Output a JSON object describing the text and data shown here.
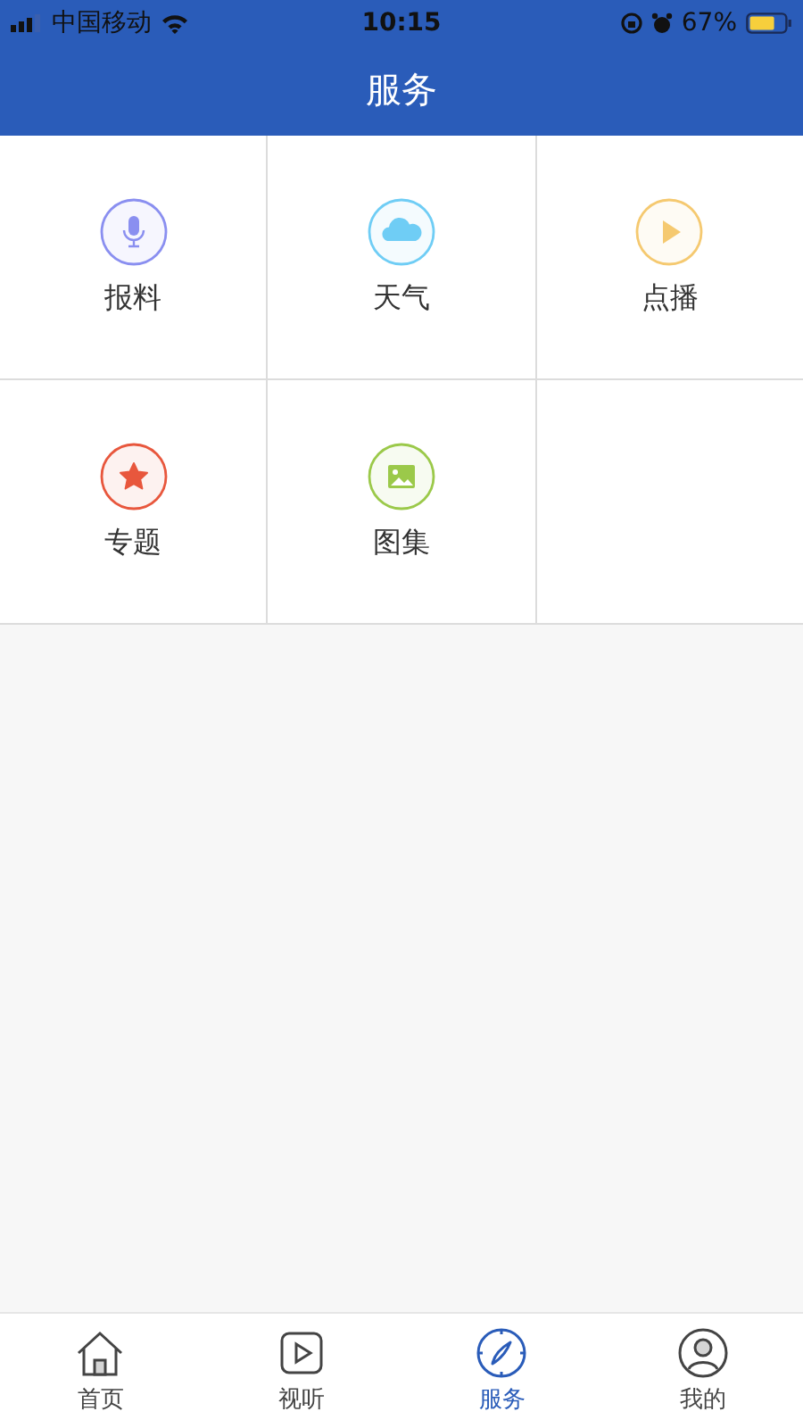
{
  "status_bar": {
    "carrier": "中国移动",
    "time": "10:15",
    "battery": "67%"
  },
  "header": {
    "title": "服务"
  },
  "services": [
    {
      "label": "报料",
      "kind": "mic",
      "color": "#8a8ff0"
    },
    {
      "label": "天气",
      "kind": "cloud",
      "color": "#6fcdf5"
    },
    {
      "label": "点播",
      "kind": "play",
      "color": "#f5c970"
    },
    {
      "label": "专题",
      "kind": "star",
      "color": "#e8573d"
    },
    {
      "label": "图集",
      "kind": "image",
      "color": "#9bc94a"
    }
  ],
  "tabs": [
    {
      "label": "首页",
      "kind": "home",
      "selected": false
    },
    {
      "label": "视听",
      "kind": "video",
      "selected": false
    },
    {
      "label": "服务",
      "kind": "compass",
      "selected": true
    },
    {
      "label": "我的",
      "kind": "user",
      "selected": false
    }
  ]
}
